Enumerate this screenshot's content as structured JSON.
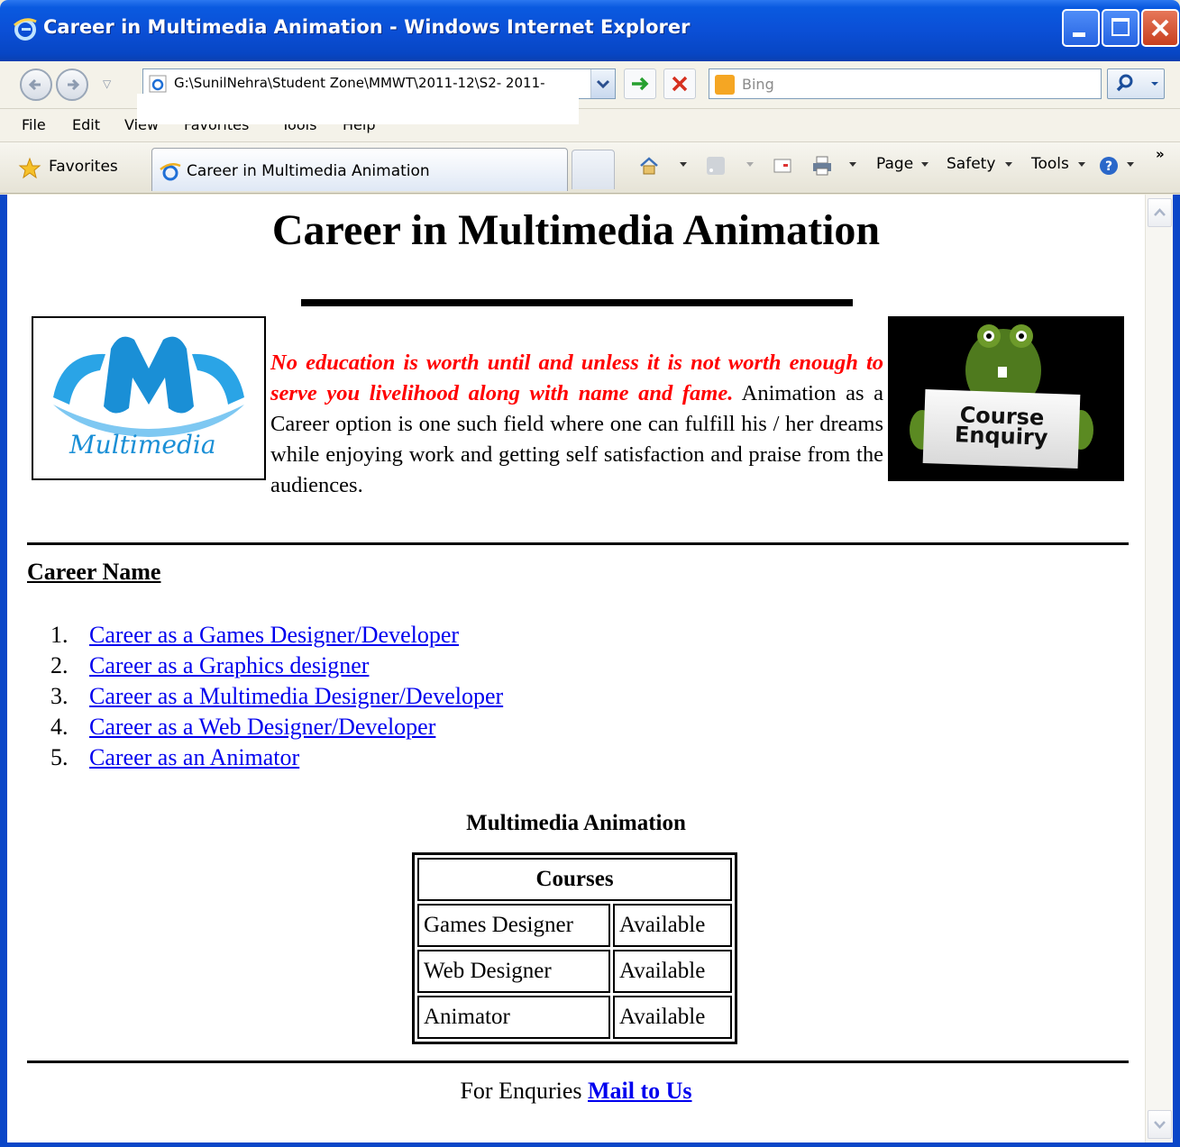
{
  "window": {
    "title": "Career in Multimedia Animation - Windows Internet Explorer",
    "buttons": {
      "minimize": "minimize",
      "maximize": "maximize",
      "close": "close"
    }
  },
  "address_bar": {
    "url": "G:\\SunilNehra\\Student Zone\\MMWT\\2011-12\\S2- 2011-",
    "search_placeholder": "Bing"
  },
  "menu": {
    "items": [
      "File",
      "Edit",
      "View",
      "Favorites",
      "Tools",
      "Help"
    ]
  },
  "favorites_bar": {
    "favorites_label": "Favorites",
    "tab_label": "Career in Multimedia Animation",
    "commands": {
      "page": "Page",
      "safety": "Safety",
      "tools": "Tools"
    }
  },
  "page": {
    "heading": "Career in Multimedia Animation",
    "logo_text": "Multimedia",
    "quote_emphasis": "No education is worth until and unless it is not worth enough to serve you livelihood along with name and fame.",
    "quote_body": " Animation as a Career option is one such field where one can fulfill his / her dreams while enjoying work and getting self satisfaction and praise from the audiences.",
    "enquiry_sign": {
      "line1": "Course",
      "line2": "Enquiry"
    },
    "career_heading": "Career Name",
    "careers": [
      {
        "num": "1.",
        "label": "Career as a Games Designer/Developer"
      },
      {
        "num": "2.",
        "label": "Career as a Graphics designer"
      },
      {
        "num": "3.",
        "label": "Career as a Multimedia Designer/Developer"
      },
      {
        "num": "4.",
        "label": "Career as a Web Designer/Developer"
      },
      {
        "num": "5.",
        "label": "Career as an Animator"
      }
    ],
    "table": {
      "caption": "Multimedia Animation",
      "header": "Courses",
      "rows": [
        {
          "course": "Games Designer",
          "status": "Available"
        },
        {
          "course": "Web Designer",
          "status": "Available"
        },
        {
          "course": "Animator",
          "status": "Available"
        }
      ]
    },
    "footer": {
      "text": "For Enquries ",
      "link": "Mail to Us"
    }
  },
  "colors": {
    "titlebar": "#0b4fd6",
    "quote_emphasis": "#ff0000",
    "link": "#0000ee",
    "logo_blue": "#1a8fd6"
  }
}
